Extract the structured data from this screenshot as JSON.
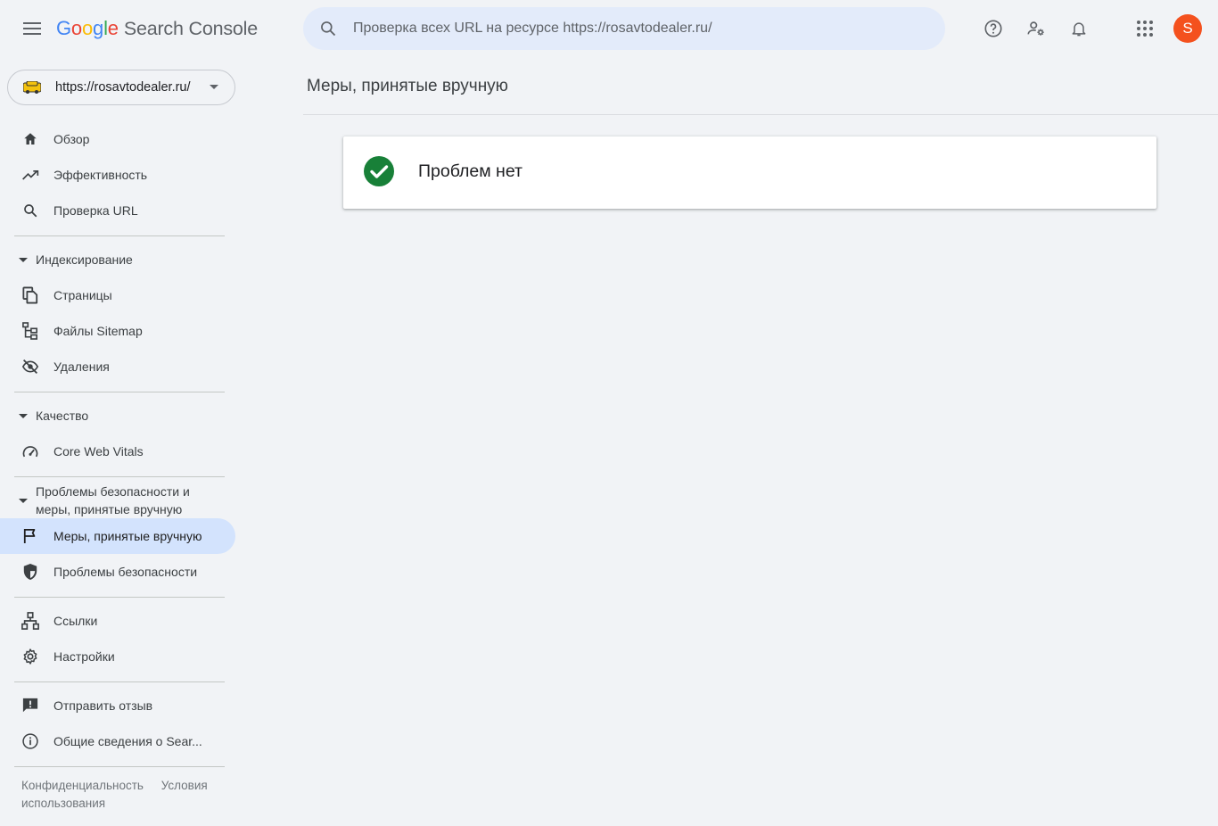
{
  "header": {
    "logo_google": [
      "G",
      "o",
      "o",
      "g",
      "l",
      "e"
    ],
    "product": "Search Console",
    "search_placeholder": "Проверка всех URL на ресурсе https://rosavtodealer.ru/",
    "avatar_letter": "S",
    "icons": [
      "menu-icon",
      "search-icon",
      "help-icon",
      "manage-users-icon",
      "notifications-icon",
      "apps-icon"
    ]
  },
  "property": {
    "url": "https://rosavtodealer.ru/"
  },
  "sidebar": {
    "top_items": [
      {
        "label": "Обзор",
        "icon": "home-icon"
      },
      {
        "label": "Эффективность",
        "icon": "trending-up-icon"
      },
      {
        "label": "Проверка URL",
        "icon": "search-icon"
      }
    ],
    "indexing": {
      "title": "Индексирование",
      "items": [
        {
          "label": "Страницы",
          "icon": "pages-icon"
        },
        {
          "label": "Файлы Sitemap",
          "icon": "sitemap-icon"
        },
        {
          "label": "Удаления",
          "icon": "visibility-off-icon"
        }
      ]
    },
    "quality": {
      "title": "Качество",
      "items": [
        {
          "label": "Core Web Vitals",
          "icon": "speed-icon"
        }
      ]
    },
    "security": {
      "title": "Проблемы безопасности и меры, принятые вручную",
      "items": [
        {
          "label": "Меры, принятые вручную",
          "icon": "flag-icon",
          "active": true
        },
        {
          "label": "Проблемы безопасности",
          "icon": "shield-icon"
        }
      ]
    },
    "more_items": [
      {
        "label": "Ссылки",
        "icon": "links-icon"
      },
      {
        "label": "Настройки",
        "icon": "settings-icon"
      }
    ],
    "bottom_items": [
      {
        "label": "Отправить отзыв",
        "icon": "feedback-icon"
      },
      {
        "label": "Общие сведения о Sear...",
        "icon": "info-icon"
      }
    ],
    "footer": {
      "privacy": "Конфиденциальность",
      "terms": "Условия использования"
    }
  },
  "main": {
    "page_title": "Меры, принятые вручную",
    "status_message": "Проблем нет"
  },
  "colors": {
    "accent_active": "#d3e3fd",
    "search_bg": "#e3ebfa",
    "success": "#188038",
    "avatar": "#f4511e"
  }
}
